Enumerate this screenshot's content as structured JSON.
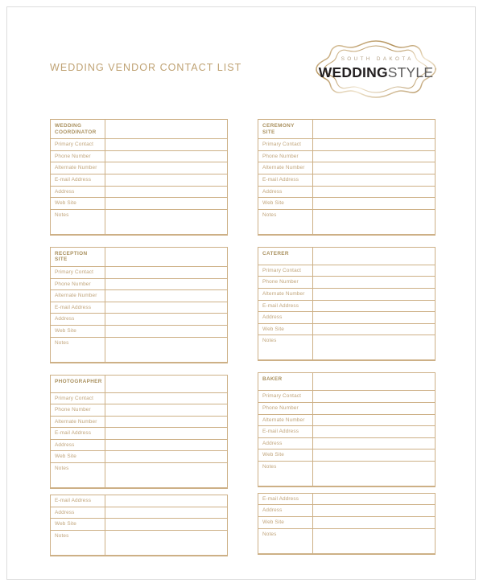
{
  "document": {
    "title": "WEDDING VENDOR CONTACT LIST"
  },
  "logo": {
    "sub_text": "SOUTH DAKOTA",
    "word_one": "WEDDING",
    "word_two": "STYLE",
    "frame_color": "#c9ab79",
    "accent_color": "#bfa273"
  },
  "field_labels": {
    "primary_contact": "Primary Contact",
    "phone_number": "Phone Number",
    "alternate_number": "Alternate Number",
    "email_address": "E-mail Address",
    "address": "Address",
    "web_site": "Web Site",
    "notes": "Notes"
  },
  "columns": {
    "left": [
      {
        "id": "wedding-coordinator",
        "header": "WEDDING\nCOORDINATOR",
        "header_lines": 2,
        "header_value": "",
        "rows": [
          {
            "label": "Primary Contact",
            "value": ""
          },
          {
            "label": "Phone Number",
            "value": ""
          },
          {
            "label": "Alternate Number",
            "value": ""
          },
          {
            "label": "E-mail Address",
            "value": ""
          },
          {
            "label": "Address",
            "value": ""
          },
          {
            "label": "Web Site",
            "value": ""
          }
        ],
        "notes": {
          "label": "Notes",
          "value": ""
        },
        "extra_block": null
      },
      {
        "id": "reception-site",
        "header": "RECEPTION\nSITE",
        "header_lines": 2,
        "header_value": "",
        "rows": [
          {
            "label": "Primary Contact",
            "value": ""
          },
          {
            "label": "Phone Number",
            "value": ""
          },
          {
            "label": "Alternate Number",
            "value": ""
          },
          {
            "label": "E-mail Address",
            "value": ""
          },
          {
            "label": "Address",
            "value": ""
          },
          {
            "label": "Web Site",
            "value": ""
          }
        ],
        "notes": {
          "label": "Notes",
          "value": ""
        },
        "extra_block": null
      },
      {
        "id": "photographer",
        "header": "PHOTOGRAPHER",
        "header_lines": 1,
        "header_value": "",
        "rows": [
          {
            "label": "Primary Contact",
            "value": ""
          },
          {
            "label": "Phone Number",
            "value": ""
          },
          {
            "label": "Alternate Number",
            "value": ""
          },
          {
            "label": "E-mail Address",
            "value": ""
          },
          {
            "label": "Address",
            "value": ""
          },
          {
            "label": "Web Site",
            "value": ""
          }
        ],
        "notes": {
          "label": "Notes",
          "value": ""
        },
        "extra_block": {
          "rows": [
            {
              "label": "E-mail Address",
              "value": ""
            },
            {
              "label": "Address",
              "value": ""
            },
            {
              "label": "Web Site",
              "value": ""
            }
          ],
          "notes": {
            "label": "Notes",
            "value": ""
          }
        }
      }
    ],
    "right": [
      {
        "id": "ceremony-site",
        "header": "CEREMONY\nSITE",
        "header_lines": 2,
        "header_value": "",
        "rows": [
          {
            "label": "Primary Contact",
            "value": ""
          },
          {
            "label": "Phone Number",
            "value": ""
          },
          {
            "label": "Alternate Number",
            "value": ""
          },
          {
            "label": "E-mail Address",
            "value": ""
          },
          {
            "label": "Address",
            "value": ""
          },
          {
            "label": "Web Site",
            "value": ""
          }
        ],
        "notes": {
          "label": "Notes",
          "value": ""
        },
        "extra_block": null
      },
      {
        "id": "caterer",
        "header": "CATERER",
        "header_lines": 1,
        "header_value": "",
        "rows": [
          {
            "label": "Primary Contact",
            "value": ""
          },
          {
            "label": "Phone Number",
            "value": ""
          },
          {
            "label": "Alternate Number",
            "value": ""
          },
          {
            "label": "E-mail Address",
            "value": ""
          },
          {
            "label": "Address",
            "value": ""
          },
          {
            "label": "Web Site",
            "value": ""
          }
        ],
        "notes": {
          "label": "Notes",
          "value": ""
        },
        "extra_block": null
      },
      {
        "id": "baker",
        "header": "BAKER",
        "header_lines": 1,
        "header_value": "",
        "rows": [
          {
            "label": "Primary Contact",
            "value": ""
          },
          {
            "label": "Phone Number",
            "value": ""
          },
          {
            "label": "Alternate Number",
            "value": ""
          },
          {
            "label": "E-mail Address",
            "value": ""
          },
          {
            "label": "Address",
            "value": ""
          },
          {
            "label": "Web Site",
            "value": ""
          }
        ],
        "notes": {
          "label": "Notes",
          "value": ""
        },
        "extra_block": {
          "rows": [
            {
              "label": "E-mail Address",
              "value": ""
            },
            {
              "label": "Address",
              "value": ""
            },
            {
              "label": "Web Site",
              "value": ""
            }
          ],
          "notes": {
            "label": "Notes",
            "value": ""
          }
        }
      }
    ]
  }
}
